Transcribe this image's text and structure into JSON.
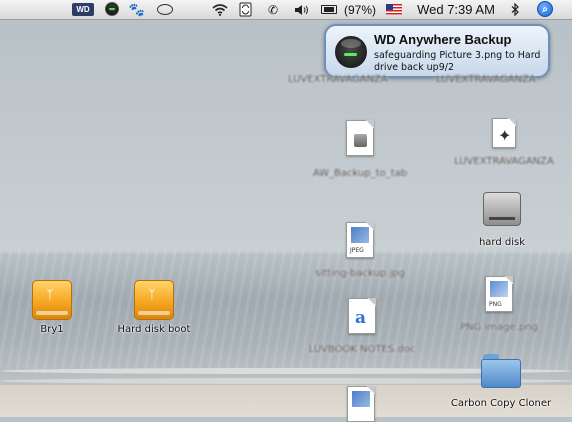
{
  "menubar": {
    "wd_logo": "WD",
    "battery_percent": "(97%)",
    "clock": "Wed 7:39 AM",
    "icons": [
      "wd-logo-icon",
      "wd-backup-status-icon",
      "paw-icon",
      "chat-bubble-icon",
      "wifi-icon",
      "sync-icon",
      "phone-icon",
      "volume-icon",
      "battery-icon",
      "us-flag-icon",
      "bluetooth-icon",
      "spotlight-icon"
    ]
  },
  "notification": {
    "title": "WD Anywhere Backup",
    "message": "safeguarding Picture 3.png to Hard drive back up9/2"
  },
  "desktop": {
    "items": [
      {
        "label": "Bry1",
        "icon": "firewire-drive-icon"
      },
      {
        "label": "Hard disk boot",
        "icon": "firewire-drive-icon"
      },
      {
        "label": "LUVEXTRAVAGANZA",
        "icon": "document-icon",
        "blurred": true
      },
      {
        "label": "LUVEXTRAVAGANZA",
        "icon": "document-icon",
        "blurred": true
      },
      {
        "label": "AW_Backup_to_tab",
        "icon": "disk-image-document-icon",
        "blurred": true
      },
      {
        "label": "LUVEXTRAVAGANZA",
        "icon": "application-document-icon",
        "blurred": true
      },
      {
        "label": "hard disk",
        "icon": "internal-hard-disk-icon"
      },
      {
        "label": "sitting-backup.jpg",
        "icon": "jpeg-document-icon",
        "blurred": true
      },
      {
        "label": "PNG image.png",
        "icon": "png-document-icon",
        "blurred": true
      },
      {
        "label": "LUVBOOK NOTES.doc",
        "icon": "word-document-icon",
        "blurred": true
      },
      {
        "label": "Carbon Copy Cloner",
        "icon": "folder-icon"
      },
      {
        "label": "",
        "icon": "jpeg-document-icon"
      }
    ]
  },
  "colors": {
    "notification_border": "#6e8fb8",
    "drive_orange": "#f6a722",
    "spotlight_blue": "#1861d6"
  }
}
